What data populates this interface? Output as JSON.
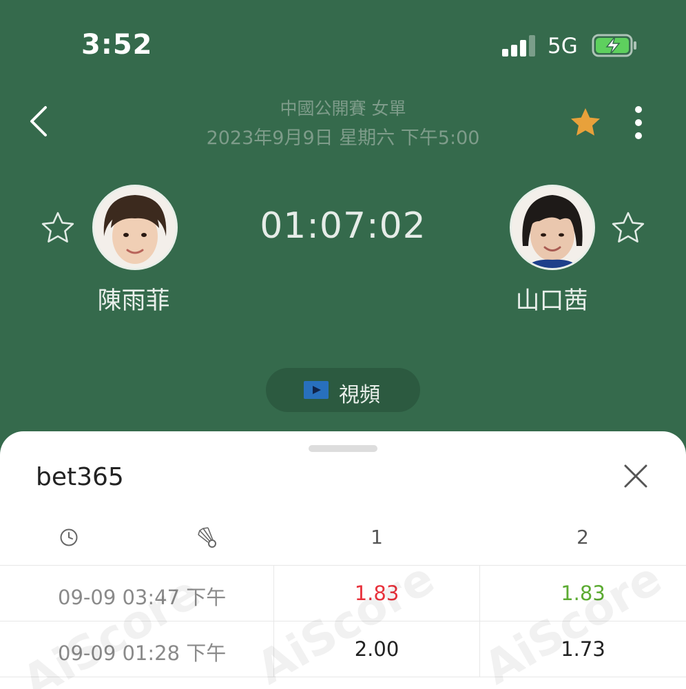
{
  "status_bar": {
    "time": "3:52",
    "network": "5G"
  },
  "header": {
    "league": "中國公開賽 女單",
    "date": "2023年9月9日 星期六 下午5:00"
  },
  "match": {
    "timer": "01:07:02",
    "home": {
      "name": "陳雨菲"
    },
    "away": {
      "name": "山口茜"
    }
  },
  "video_button": {
    "label": "視頻"
  },
  "odds_sheet": {
    "bookmaker": "bet365",
    "columns": {
      "home": "1",
      "away": "2"
    },
    "rows": [
      {
        "time": "09-09 03:47 下午",
        "home": "1.83",
        "away": "1.83",
        "home_color": "#e8323c",
        "away_color": "#5cab32"
      },
      {
        "time": "09-09 01:28 下午",
        "home": "2.00",
        "away": "1.73",
        "home_color": "#222222",
        "away_color": "#222222"
      }
    ],
    "watermark": "AiScore"
  },
  "colors": {
    "header_bg": "#356a4c",
    "favorite_star": "#e8a13b",
    "odds_up": "#e8323c",
    "odds_down": "#5cab32"
  }
}
